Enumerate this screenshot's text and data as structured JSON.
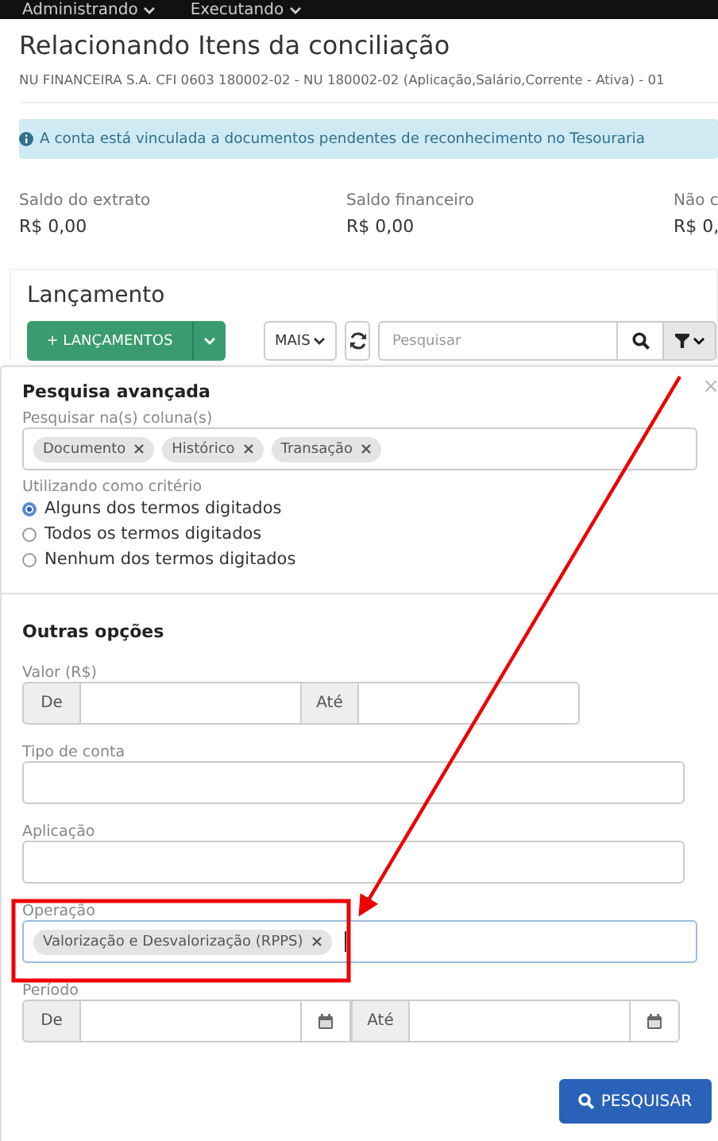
{
  "top_menu": [
    {
      "label": "Administrando"
    },
    {
      "label": "Executando"
    }
  ],
  "dialog": {
    "title": "Relacionando Itens da conciliação",
    "subtitle": "NU FINANCEIRA S.A. CFI 0603 180002-02 - NU 180002-02 (Aplicação,Salário,Corrente - Ativa) - 01",
    "alert": "A conta está vinculada a documentos pendentes de reconhecimento no Tesouraria"
  },
  "balances": [
    {
      "label": "Saldo do extrato",
      "value": "R$ 0,00"
    },
    {
      "label": "Saldo financeiro",
      "value": "R$ 0,00"
    },
    {
      "label": "Não c",
      "value": "R$ 0,"
    }
  ],
  "section": {
    "title": "Lançamento",
    "add_button": "+ LANÇAMENTOS",
    "more_button": "MAIS",
    "search": {
      "placeholder": "Pesquisar"
    }
  },
  "advanced_search": {
    "title": "Pesquisa avançada",
    "close": "×",
    "columns_label": "Pesquisar na(s) coluna(s)",
    "columns": [
      {
        "label": "Documento"
      },
      {
        "label": "Histórico"
      },
      {
        "label": "Transação"
      }
    ],
    "criteria_label": "Utilizando como critério",
    "criteria": [
      {
        "label": "Alguns dos termos digitados",
        "selected": true
      },
      {
        "label": "Todos os termos digitados",
        "selected": false
      },
      {
        "label": "Nenhum dos termos digitados",
        "selected": false
      }
    ],
    "other_title": "Outras opções",
    "fields": [
      {
        "kind": "range",
        "label": "Valor (R$)",
        "from": "De",
        "to": "Até",
        "calendar": false
      },
      {
        "kind": "text",
        "label": "Tipo de conta"
      },
      {
        "kind": "text",
        "label": "Aplicação"
      },
      {
        "kind": "tags",
        "label": "Operação",
        "focused": true,
        "highlighted": true,
        "tags": [
          {
            "label": "Valorização e Desvalorização (RPPS)"
          }
        ]
      },
      {
        "kind": "range",
        "label": "Período",
        "from": "De",
        "to": "Até",
        "calendar": true
      }
    ],
    "submit": "PESQUISAR"
  }
}
